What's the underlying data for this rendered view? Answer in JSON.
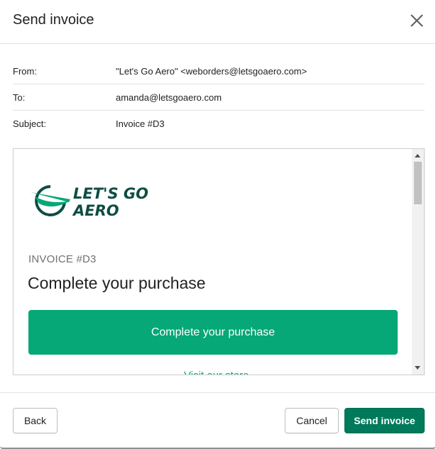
{
  "dialog": {
    "title": "Send invoice"
  },
  "email": {
    "from_label": "From:",
    "from_value": "\"Let's Go Aero\" <weborders@letsgoaero.com>",
    "to_label": "To:",
    "to_value": "amanda@letsgoaero.com",
    "subject_label": "Subject:",
    "subject_value": "Invoice #D3"
  },
  "preview": {
    "logo_line1": "LET'S GO",
    "logo_line2": "AERO",
    "invoice_label": "INVOICE #D3",
    "heading": "Complete your purchase",
    "cta_label": "Complete your purchase",
    "visit_link_partial": "Visit our store"
  },
  "footer": {
    "back_label": "Back",
    "cancel_label": "Cancel",
    "send_label": "Send invoice"
  },
  "colors": {
    "brand_green": "#05a876",
    "primary_button": "#007a5a",
    "logo_dark": "#0e4d43"
  },
  "icons": {
    "close": "close-icon",
    "logo": "swoosh-logo-icon"
  }
}
